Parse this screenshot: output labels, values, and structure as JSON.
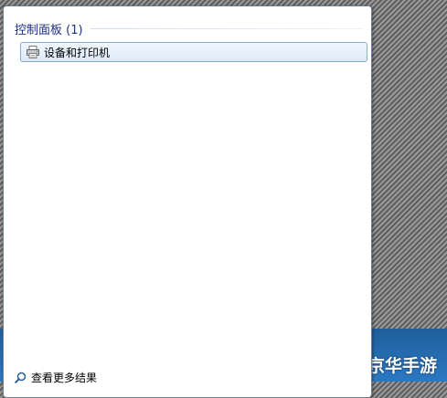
{
  "panel": {
    "group_title": "控制面板 (1)",
    "result_label": "设备和打印机",
    "result_icon": "printer-icon",
    "more_results_label": "查看更多结果",
    "more_results_icon": "search-icon"
  },
  "watermark": {
    "text": "京华手游"
  },
  "colors": {
    "group_title": "#1e3287",
    "selection_border": "#84acdd",
    "selection_fill": "#dce9f9"
  }
}
